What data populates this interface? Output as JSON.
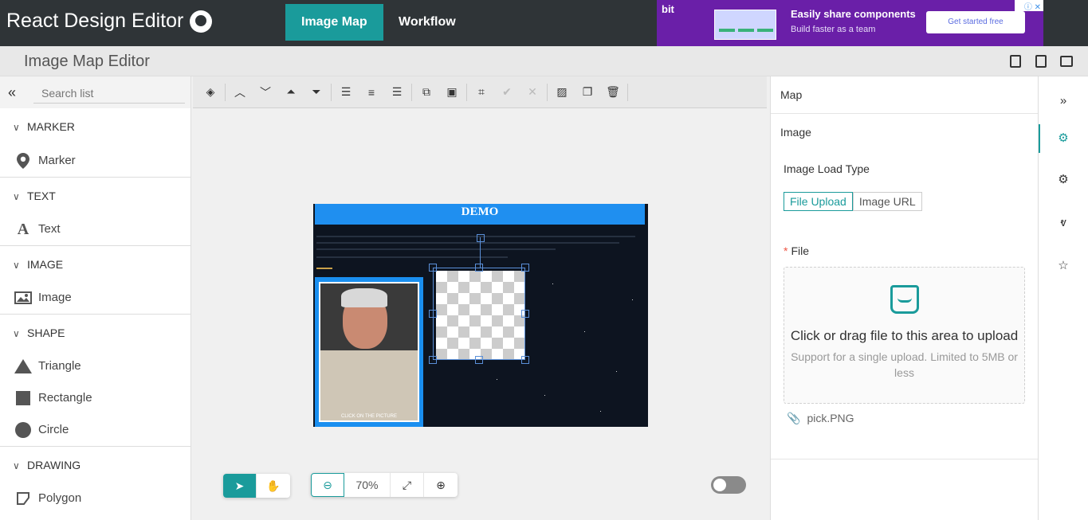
{
  "app": {
    "title": "React Design Editor"
  },
  "tabs": [
    {
      "label": "Image Map"
    },
    {
      "label": "Workflow"
    }
  ],
  "ad": {
    "brand": "bit",
    "headline": "Easily share components",
    "sub": "Build faster as a team",
    "cta": "Get started free"
  },
  "editor": {
    "title": "Image Map Editor"
  },
  "left": {
    "search_placeholder": "Search list",
    "groups": [
      {
        "label": "MARKER",
        "items": [
          "Marker"
        ]
      },
      {
        "label": "TEXT",
        "items": [
          "Text"
        ]
      },
      {
        "label": "IMAGE",
        "items": [
          "Image"
        ]
      },
      {
        "label": "SHAPE",
        "items": [
          "Triangle",
          "Rectangle",
          "Circle"
        ]
      },
      {
        "label": "DRAWING",
        "items": [
          "Polygon"
        ]
      }
    ]
  },
  "canvas": {
    "demo_title": "DEMO",
    "zoom": "70%",
    "photo_caption": "CLICK ON THE PICTURE"
  },
  "right": {
    "sections": [
      "Map",
      "Image"
    ],
    "load_type_label": "Image Load Type",
    "options": [
      "File Upload",
      "Image URL"
    ],
    "file_label": "File",
    "upload_text": "Click or drag file to this area to upload",
    "upload_hint": "Support for a single upload. Limited to 5MB or less",
    "file_name": "pick.PNG"
  },
  "colors": {
    "accent": "#1a9b9b",
    "topbar": "#2f3437",
    "ad": "#6a1fa8",
    "demo_header": "#1f8ff0"
  }
}
